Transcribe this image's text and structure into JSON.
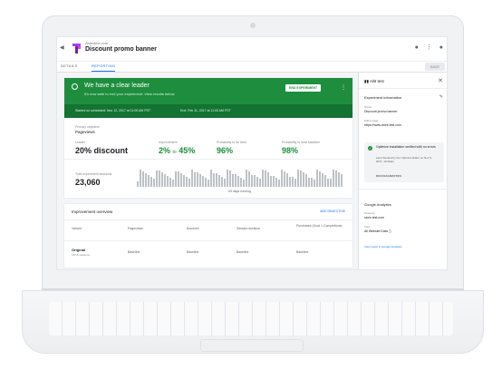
{
  "app": {
    "account": "Aidestest.com",
    "title": "Discount promo banner",
    "tabs": [
      "DETAILS",
      "REPORTING"
    ],
    "save_label": "SAVE"
  },
  "banner": {
    "title": "We have a clear leader",
    "subtitle": "It's now safe to end your experiment. View results below.",
    "end_button": "END EXPERIMENT",
    "started": "Started on scheduled: Nov 12, 2017 at 11:00 AM PST",
    "ended": "End: Feb 11, 2017 at 11:00 AM PST"
  },
  "stats": {
    "objective_label": "Primary objective",
    "objective_value": "Pageviews",
    "leader_label": "Leader",
    "leader_value": "20% discount",
    "improvement_label": "Improvement",
    "improvement_low": "2%",
    "improvement_to": "to",
    "improvement_high": "45%",
    "prob_best_label": "Probability to be best",
    "prob_best_value": "96%",
    "prob_baseline_label": "Probability to beat baseline",
    "prob_baseline_value": "98%",
    "sessions_label": "Total experiment sessions",
    "sessions_value": "23,060",
    "days_running": "63 days running"
  },
  "improvement": {
    "title": "Improvement overview",
    "add_objective": "ADD OBJECTIVE",
    "headers": [
      "Variant",
      "Pageviews",
      "Bounces",
      "Session duration",
      "Purchases (Goal 1 Completions)"
    ],
    "row": {
      "name": "Original",
      "sub": "14/15 sessions",
      "cells": [
        "Baseline",
        "Baseline",
        "Baseline",
        "Baseline"
      ]
    }
  },
  "side": {
    "title": "A/B test",
    "section": "Experiment information",
    "name_label": "Name",
    "name_value": "Discount promo banner",
    "editor_label": "Editor page",
    "editor_value": "https://www.store.test.com",
    "optimize_text": "Optimize installation verified with no errors",
    "optimize_sub": "Last checked by the Optimize Editor on Nov 6, 2017, 10:20am",
    "diagnostics": "RUN DIAGNOSTICS",
    "ga_title": "Google Analytics",
    "property_label": "Property",
    "property_value": "store.test.com",
    "view_label": "View",
    "view_value": "All Website Data",
    "view_link": "View report in Google Analytics"
  }
}
